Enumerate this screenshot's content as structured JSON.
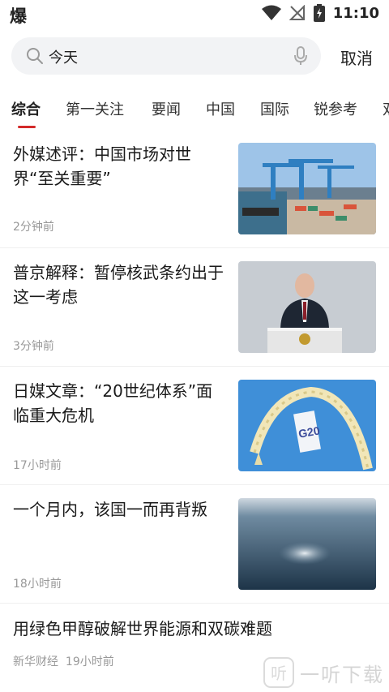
{
  "status_bar": {
    "app_glyph": "爆",
    "time": "11:10"
  },
  "search": {
    "query": "今天",
    "cancel_label": "取消"
  },
  "tabs": [
    {
      "label": "综合",
      "active": true
    },
    {
      "label": "第一关注"
    },
    {
      "label": "要闻"
    },
    {
      "label": "中国"
    },
    {
      "label": "国际"
    },
    {
      "label": "锐参考"
    },
    {
      "label": "双"
    }
  ],
  "news": [
    {
      "title": "外媒述评：中国市场对世界“至关重要”",
      "meta": "2分钟前",
      "image": "port-cranes"
    },
    {
      "title": "普京解释：暂停核武条约出于这一考虑",
      "meta": "3分钟前",
      "image": "speaker-podium"
    },
    {
      "title": "日媒文章：“20世纪体系”面临重大危机",
      "meta": "17小时前",
      "image": "g20-decoration"
    },
    {
      "title": "一个月内，该国一而再背叛",
      "meta": "18小时前",
      "image": "sea-aerial"
    },
    {
      "title": "用绿色甲醇破解世界能源和双碳难题",
      "source": "新华财经",
      "meta": "19小时前"
    }
  ],
  "watermark": {
    "text": "一听下载"
  },
  "colors": {
    "accent": "#d32a2a",
    "search_bg": "#f2f3f5"
  }
}
